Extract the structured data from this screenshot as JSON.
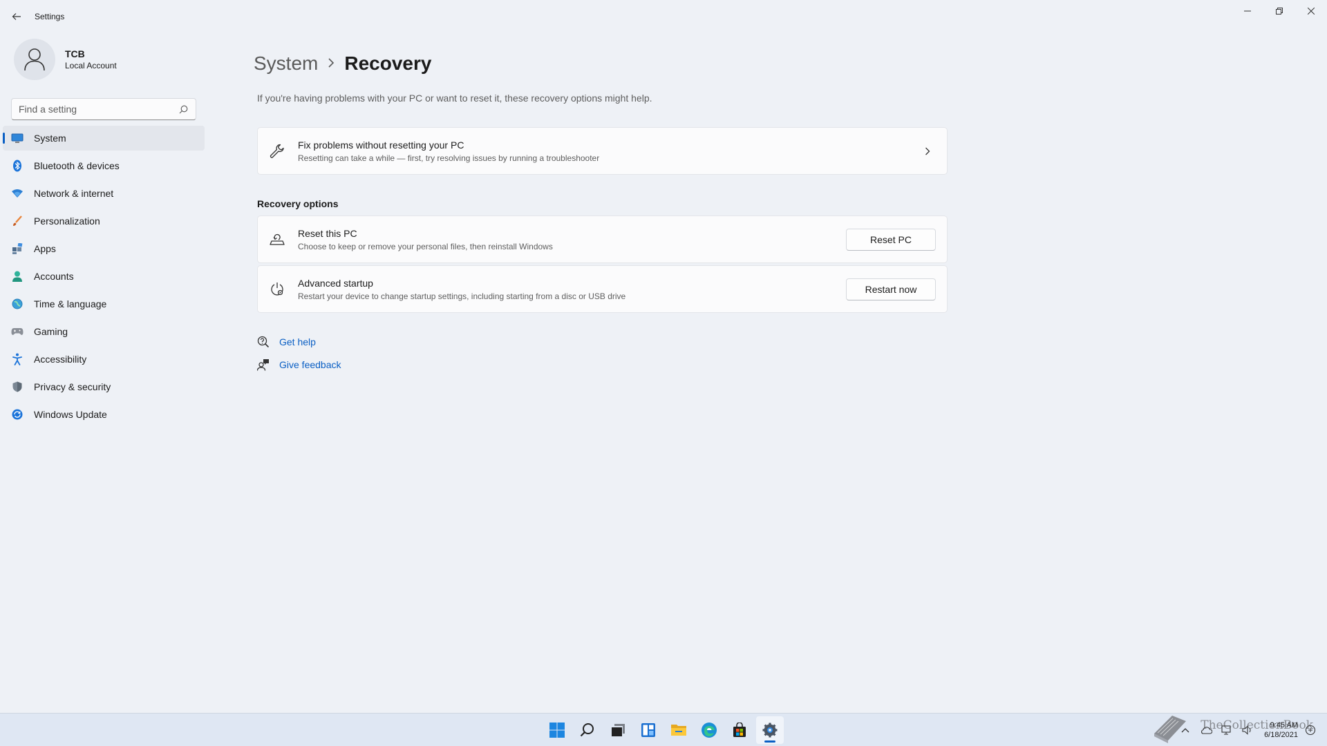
{
  "window": {
    "title": "Settings",
    "minimize_icon": "minimize-icon",
    "restore_icon": "restore-icon",
    "close_icon": "close-icon"
  },
  "profile": {
    "name": "TCB",
    "account_type": "Local Account"
  },
  "search": {
    "placeholder": "Find a setting"
  },
  "sidebar": {
    "items": [
      {
        "label": "System",
        "icon": "system-icon",
        "active": true
      },
      {
        "label": "Bluetooth & devices",
        "icon": "bluetooth-icon"
      },
      {
        "label": "Network & internet",
        "icon": "network-icon"
      },
      {
        "label": "Personalization",
        "icon": "personalization-icon"
      },
      {
        "label": "Apps",
        "icon": "apps-icon"
      },
      {
        "label": "Accounts",
        "icon": "accounts-icon"
      },
      {
        "label": "Time & language",
        "icon": "time-language-icon"
      },
      {
        "label": "Gaming",
        "icon": "gaming-icon"
      },
      {
        "label": "Accessibility",
        "icon": "accessibility-icon"
      },
      {
        "label": "Privacy & security",
        "icon": "privacy-icon"
      },
      {
        "label": "Windows Update",
        "icon": "windows-update-icon"
      }
    ]
  },
  "main": {
    "breadcrumb_parent": "System",
    "breadcrumb_current": "Recovery",
    "intro": "If you're having problems with your PC or want to reset it, these recovery options might help.",
    "fix_card": {
      "title": "Fix problems without resetting your PC",
      "subtitle": "Resetting can take a while — first, try resolving issues by running a troubleshooter"
    },
    "section_title": "Recovery options",
    "reset_card": {
      "title": "Reset this PC",
      "subtitle": "Choose to keep or remove your personal files, then reinstall Windows",
      "button": "Reset PC"
    },
    "advanced_card": {
      "title": "Advanced startup",
      "subtitle": "Restart your device to change startup settings, including starting from a disc or USB drive",
      "button": "Restart now"
    },
    "links": {
      "get_help": "Get help",
      "give_feedback": "Give feedback"
    }
  },
  "taskbar": {
    "apps": [
      "start-icon",
      "search-icon",
      "task-view-icon",
      "widgets-icon",
      "file-explorer-icon",
      "edge-icon",
      "store-icon",
      "settings-icon"
    ],
    "time": "9:45 AM",
    "date": "6/18/2021",
    "watermark": "TheCollectionBook"
  },
  "colors": {
    "accent": "#0a5fc4",
    "background": "#eef1f6",
    "card": "#fbfbfc"
  }
}
